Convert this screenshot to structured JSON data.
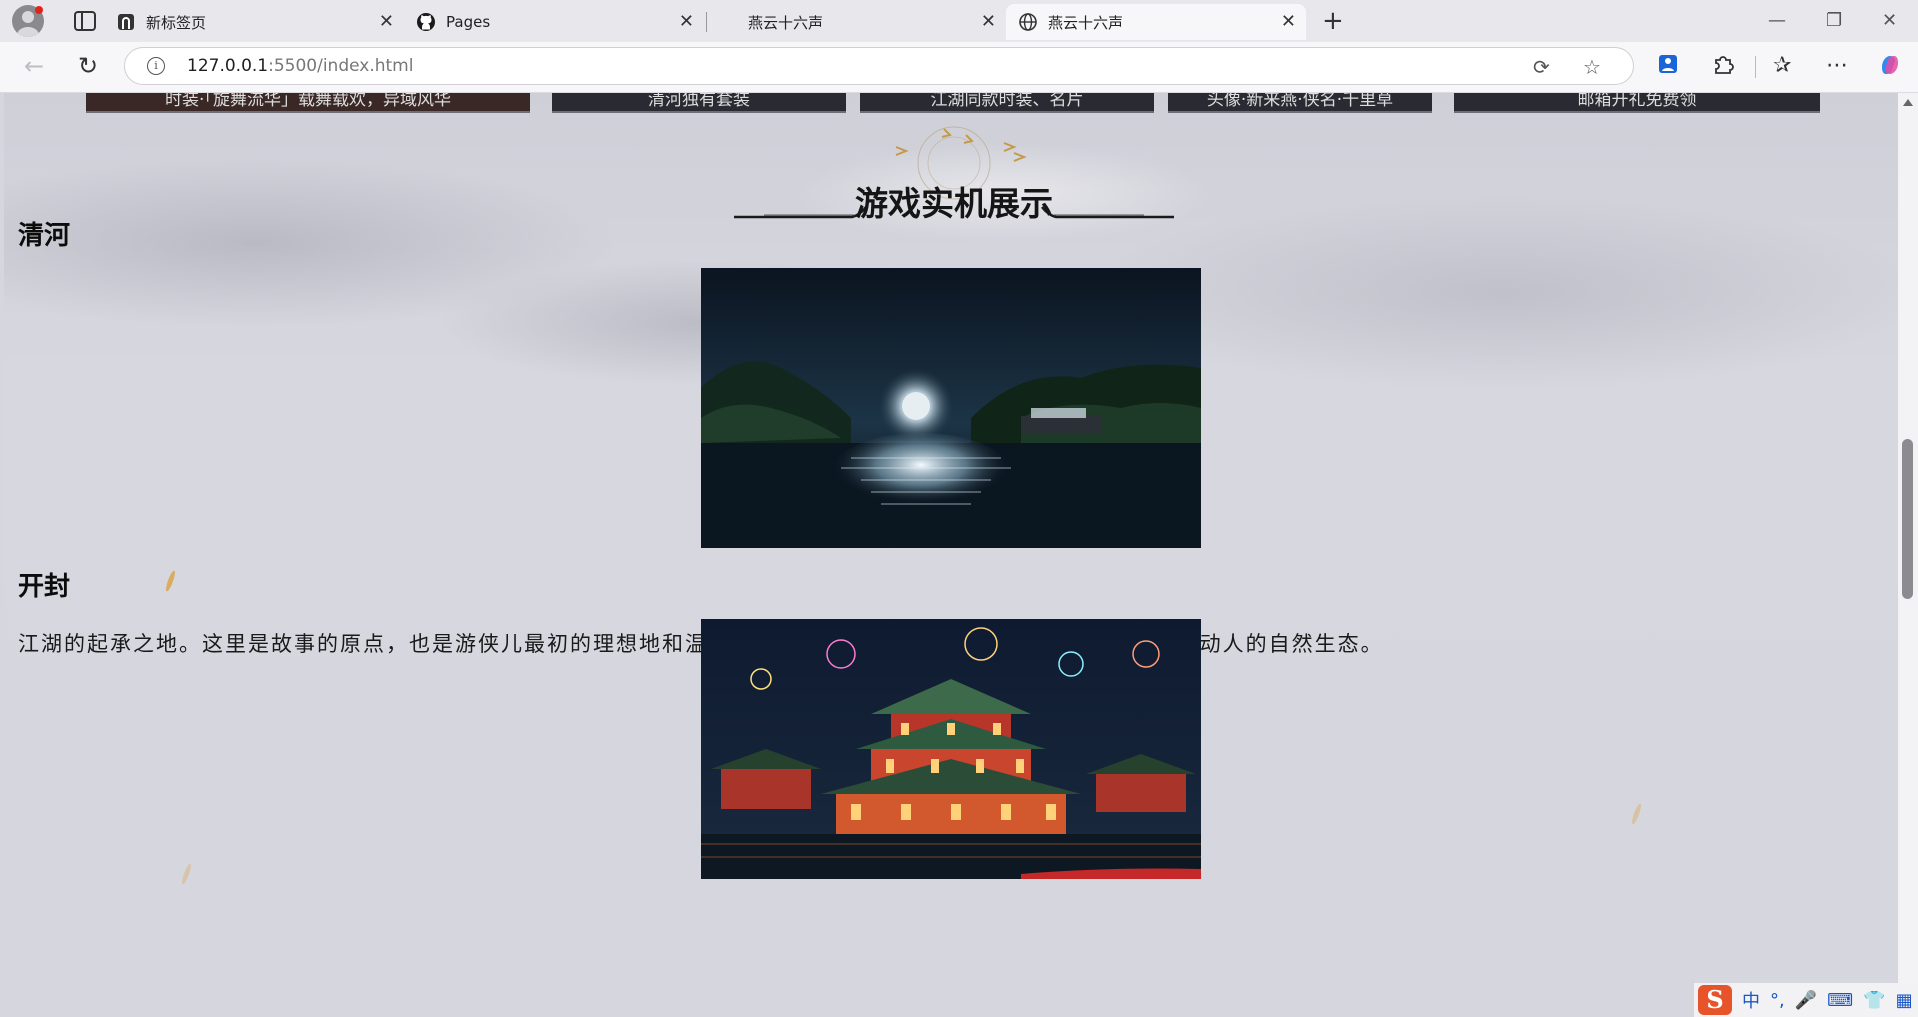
{
  "browser": {
    "tabs": [
      {
        "title": "新标签页",
        "icon": "new-tab-page-icon",
        "active": false
      },
      {
        "title": "Pages",
        "icon": "github-icon",
        "active": false
      },
      {
        "title": "燕云十六声",
        "icon": "",
        "active": false
      },
      {
        "title": "燕云十六声",
        "icon": "globe-icon",
        "active": true
      }
    ],
    "url_host": "127.0.0.1",
    "url_rest": ":5500/index.html"
  },
  "page": {
    "banners": [
      "时装·「旋舞流华」载舞载欢，异域风华",
      "清河独有套装",
      "江湖同款时装、名片",
      "头像·新来燕·侠名·千里草",
      "邮箱开礼免费领"
    ],
    "section_title": "游戏实机展示",
    "regions": [
      {
        "name": "清河",
        "description": "江湖的起承之地。这里是故事的原点，也是游侠儿最初的理想地和温柔乡。 清河有大片的原野，朴实的村庄，和各种动人的自然生态。"
      },
      {
        "name": "开封",
        "description": ""
      }
    ]
  },
  "ime": {
    "logo": "S",
    "lang": "中",
    "punct": "°,"
  }
}
